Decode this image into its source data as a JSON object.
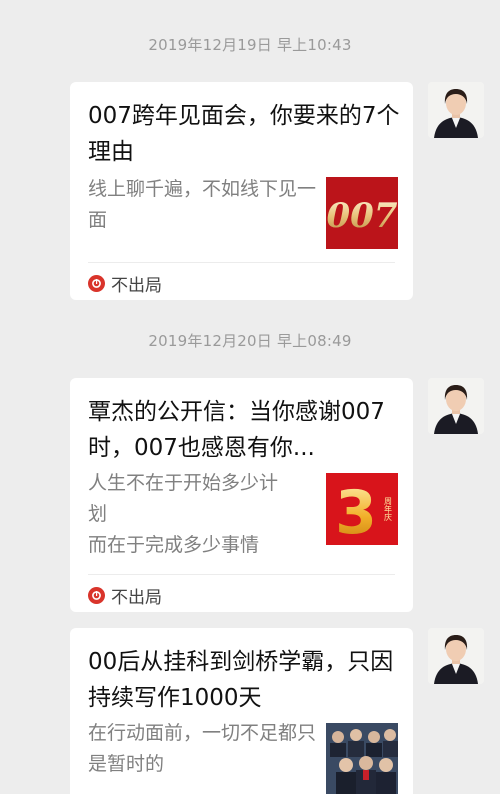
{
  "messages": [
    {
      "timestamp": "2019年12月19日 早上10:43",
      "title": "007跨年见面会，你要来的7个理由",
      "description": "线上聊千遍，不如线下见一面",
      "thumbnail_text": "007",
      "source": "不出局"
    },
    {
      "timestamp": "2019年12月20日 早上08:49",
      "title": "覃杰的公开信：当你感谢007时，007也感恩有你...",
      "description_lines": [
        "人生不在于开始多少计",
        "划",
        "而在于完成多少事情"
      ],
      "thumbnail_text": "3",
      "thumbnail_side_text": "周年庆",
      "source": "不出局"
    },
    {
      "title": "00后从挂科到剑桥学霸，只因持续写作1000天",
      "description": "在行动面前，一切不足都只是暂时的"
    }
  ],
  "colors": {
    "background": "#ededed",
    "card": "#ffffff",
    "brand_red": "#d9342b"
  }
}
